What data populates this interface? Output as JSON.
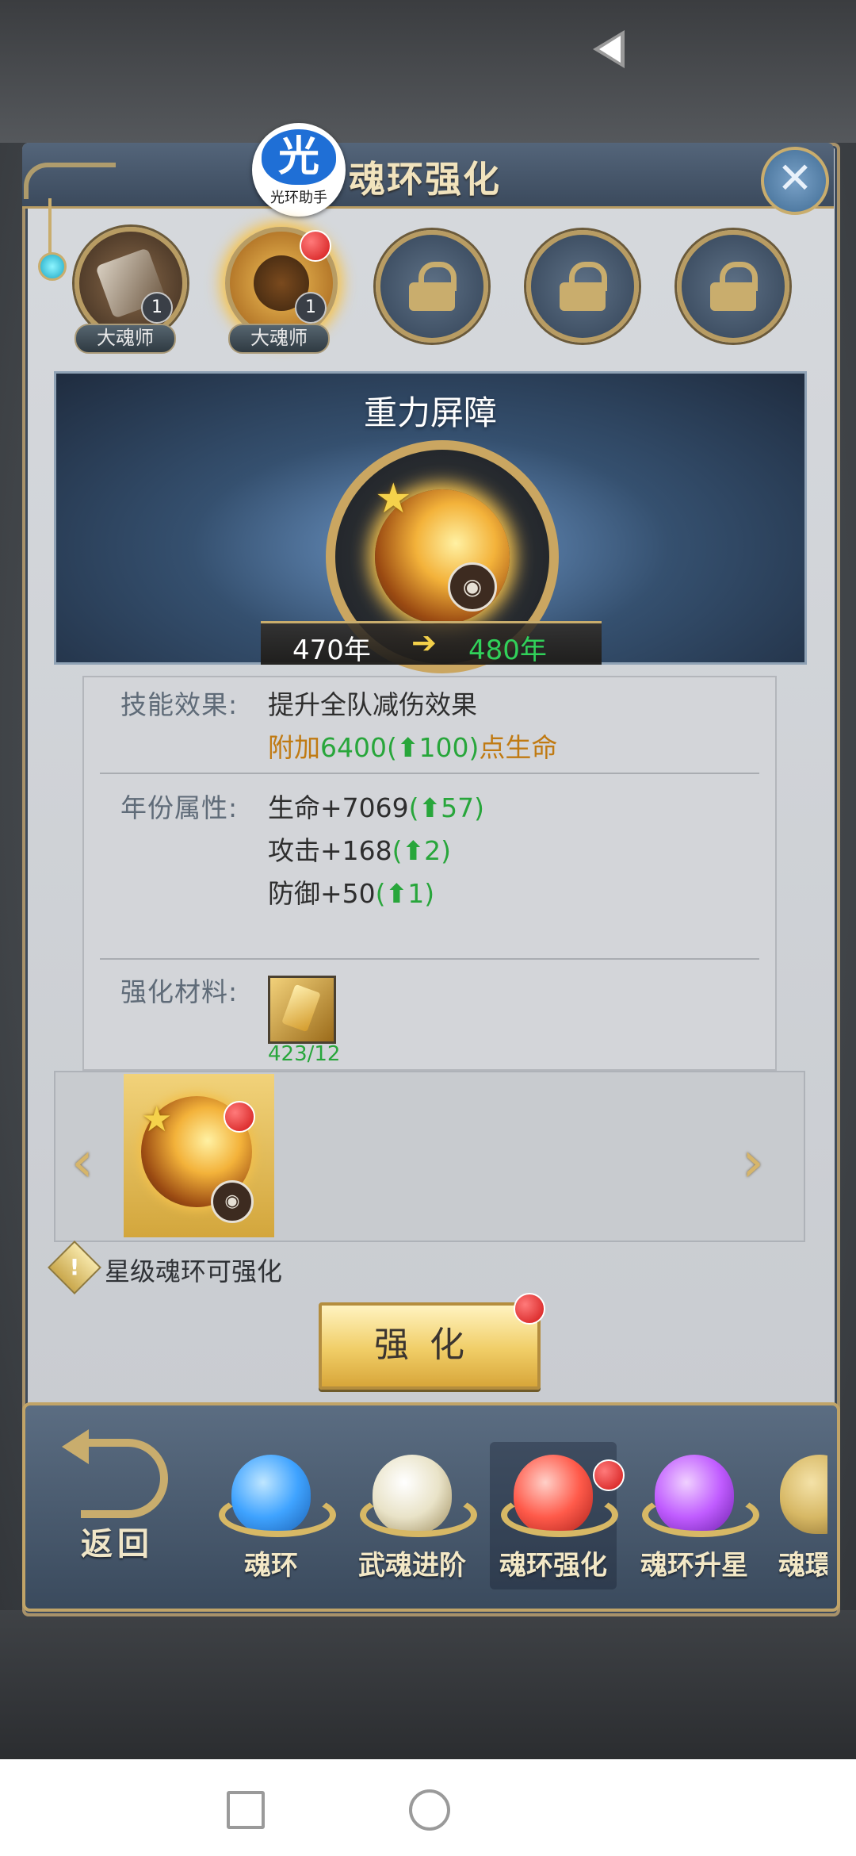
{
  "header": {
    "title": "魂环强化",
    "logo_text": "光",
    "logo_caption": "光环助手",
    "close_icon": "close-icon"
  },
  "slots": [
    {
      "label": "大魂师",
      "count": "1",
      "icon": "hammer-icon",
      "badge": false
    },
    {
      "label": "大魂师",
      "count": "1",
      "icon": "lion-icon",
      "badge": true
    },
    {
      "icon": "lock-icon",
      "locked": true
    },
    {
      "icon": "lock-icon",
      "locked": true
    },
    {
      "icon": "lock-icon",
      "locked": true
    }
  ],
  "skill": {
    "name": "重力屏障",
    "year_from": "470年",
    "year_to": "480年",
    "star_icon": "star-icon",
    "beast_icon": "beast-icon"
  },
  "info": {
    "effect_label": "技能效果:",
    "effect_text": "提升全队减伤效果",
    "effect_bonus_prefix": "附加",
    "effect_bonus_value": "6400",
    "effect_bonus_open": "(",
    "effect_bonus_up": "100",
    "effect_bonus_close": ")",
    "effect_bonus_suffix": "点生命",
    "attr_label": "年份属性:",
    "attrs": [
      {
        "text": "生命+7069",
        "open": "(",
        "up": "57",
        "close": ")"
      },
      {
        "text": "攻击+168",
        "open": "(",
        "up": "2",
        "close": ")"
      },
      {
        "text": "防御+50",
        "open": "(",
        "up": "1",
        "close": ")"
      }
    ],
    "material_label": "强化材料:",
    "material_count": "423/12"
  },
  "tip": {
    "icon": "exclamation",
    "text": "星级魂环可强化"
  },
  "strengthen_button": "强化",
  "nav": {
    "back_label": "返回",
    "items": [
      {
        "label": "魂环",
        "icon": "blue-gem-icon",
        "color": "#3fa3ff",
        "active": false,
        "badge": false
      },
      {
        "label": "武魂进阶",
        "icon": "crest-icon",
        "color": "#e9e3c8",
        "active": false,
        "badge": false
      },
      {
        "label": "魂环强化",
        "icon": "red-gem-icon",
        "color": "#ff5a4a",
        "active": true,
        "badge": true
      },
      {
        "label": "魂环升星",
        "icon": "purple-gem-icon",
        "color": "#c05cff",
        "active": false,
        "badge": false
      },
      {
        "label": "魂環",
        "icon": "partial-icon",
        "color": "#d7b865",
        "active": false,
        "badge": false
      }
    ]
  }
}
